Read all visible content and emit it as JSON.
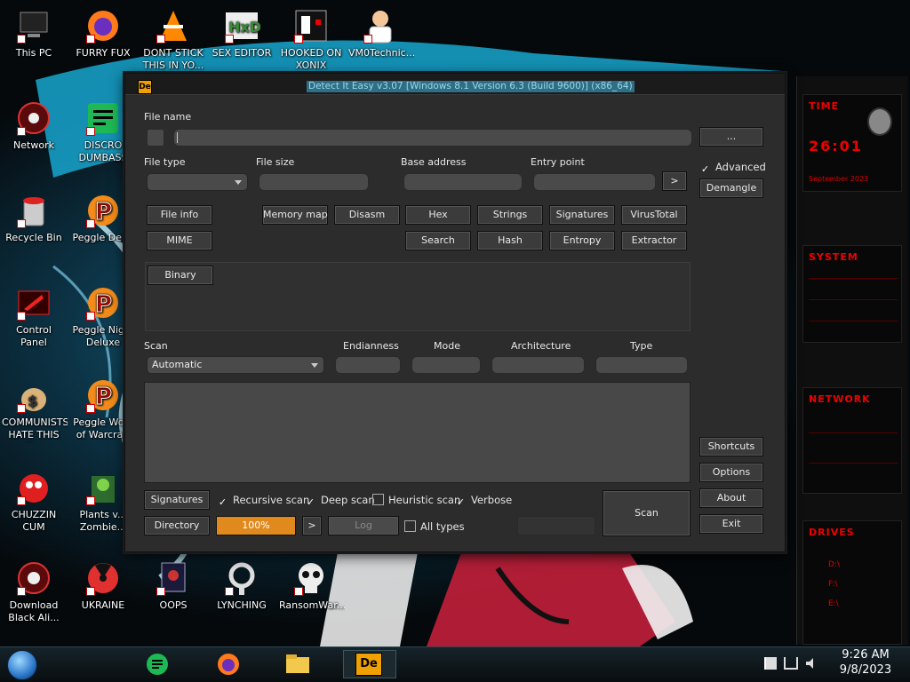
{
  "desktop": {
    "icons": [
      {
        "label": "This PC",
        "icon": "this-pc-icon"
      },
      {
        "label": "FURRY FUX",
        "icon": "firefox-icon"
      },
      {
        "label": "DONT STICK THIS IN YO...",
        "icon": "vlc-icon"
      },
      {
        "label": "SEX EDITOR",
        "icon": "hxd-icon"
      },
      {
        "label": "HOOKED ON XONIX",
        "icon": "xonix-icon"
      },
      {
        "label": "VM0Technic...",
        "icon": "doctor-icon"
      },
      {
        "label": "Network",
        "icon": "network-icon"
      },
      {
        "label": "DISCRO DUMBASS",
        "icon": "chat-icon"
      },
      {
        "label": "Recycle Bin",
        "icon": "recycle-bin-icon"
      },
      {
        "label": "Peggle Del...",
        "icon": "peggle-icon"
      },
      {
        "label": "Control Panel",
        "icon": "control-panel-icon"
      },
      {
        "label": "Peggle Nig... Deluxe",
        "icon": "peggle-icon"
      },
      {
        "label": "COMMUNISTS HATE THIS G...",
        "icon": "money-bag-icon"
      },
      {
        "label": "Peggle Wo... of Warcraft",
        "icon": "peggle-icon"
      },
      {
        "label": "CHUZZIN CUM",
        "icon": "chuzzle-icon"
      },
      {
        "label": "Plants v... Zombie...",
        "icon": "plants-icon"
      },
      {
        "label": "Download Black Ali...",
        "icon": "download-icon"
      },
      {
        "label": "UKRAINE",
        "icon": "radiation-icon"
      },
      {
        "label": "OOPS",
        "icon": "oops-icon"
      },
      {
        "label": "LYNCHING",
        "icon": "rope-icon"
      },
      {
        "label": "RansomWar...",
        "icon": "skull-icon"
      }
    ]
  },
  "window": {
    "title": "Detect It Easy v3.07 [Windows 8.1 Version 6.3 (Build 9600)] (x86_64)",
    "app_icon_text": "De",
    "labels": {
      "file_name": "File name",
      "file_type": "File type",
      "file_size": "File size",
      "base_address": "Base address",
      "entry_point": "Entry point",
      "scan": "Scan",
      "endianness": "Endianness",
      "mode": "Mode",
      "architecture": "Architecture",
      "type": "Type"
    },
    "buttons": {
      "browse": "...",
      "entry_next": ">",
      "demangle": "Demangle",
      "file_info": "File info",
      "memory_map": "Memory map",
      "disasm": "Disasm",
      "hex": "Hex",
      "strings": "Strings",
      "signatures_tool": "Signatures",
      "virustotal": "VirusTotal",
      "mime": "MIME",
      "search": "Search",
      "hash": "Hash",
      "entropy": "Entropy",
      "extractor": "Extractor",
      "binary": "Binary",
      "shortcuts": "Shortcuts",
      "options": "Options",
      "about": "About",
      "exit": "Exit",
      "signatures": "Signatures",
      "directory": "Directory",
      "progress_next": ">",
      "log": "Log",
      "scan": "Scan"
    },
    "checkboxes": {
      "advanced": {
        "label": "Advanced",
        "checked": true
      },
      "recursive_scan": {
        "label": "Recursive scan",
        "checked": true
      },
      "deep_scan": {
        "label": "Deep scan",
        "checked": true
      },
      "heuristic_scan": {
        "label": "Heuristic scan",
        "checked": false
      },
      "verbose": {
        "label": "Verbose",
        "checked": true
      },
      "all_types": {
        "label": "All types",
        "checked": false
      }
    },
    "scan_mode": "Automatic",
    "progress": {
      "value": 1.0,
      "label": "100%"
    },
    "colors": {
      "progress": "#e08a1e",
      "accent_title": "#2e6f86"
    }
  },
  "gadgets": {
    "time": "TIME",
    "clock": "26:01",
    "date": "September 2023",
    "system": "SYSTEM",
    "network": "NETWORK",
    "drives": "DRIVES",
    "drive_rows": [
      "D:\\",
      "F:\\",
      "E:\\"
    ]
  },
  "taskbar": {
    "time": "9:26 AM",
    "date": "9/8/2023",
    "apps": [
      "chat-icon",
      "firefox-icon",
      "file-explorer-icon",
      "die-icon"
    ]
  }
}
